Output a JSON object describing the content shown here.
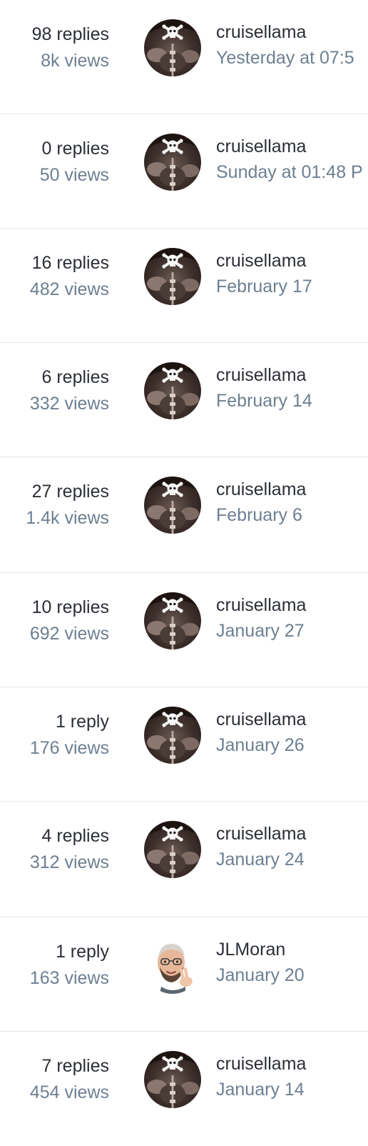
{
  "topics": [
    {
      "replies": "98 replies",
      "views": "8k views",
      "poster": "cruisellama",
      "date": "Yesterday at 07:5",
      "avatar": "pirate-skull-avatar"
    },
    {
      "replies": "0 replies",
      "views": "50 views",
      "poster": "cruisellama",
      "date": "Sunday at 01:48 P",
      "avatar": "pirate-skull-avatar"
    },
    {
      "replies": "16 replies",
      "views": "482 views",
      "poster": "cruisellama",
      "date": "February 17",
      "avatar": "pirate-skull-avatar"
    },
    {
      "replies": "6 replies",
      "views": "332 views",
      "poster": "cruisellama",
      "date": "February 14",
      "avatar": "pirate-skull-avatar"
    },
    {
      "replies": "27 replies",
      "views": "1.4k views",
      "poster": "cruisellama",
      "date": "February 6",
      "avatar": "pirate-skull-avatar"
    },
    {
      "replies": "10 replies",
      "views": "692 views",
      "poster": "cruisellama",
      "date": "January 27",
      "avatar": "pirate-skull-avatar"
    },
    {
      "replies": "1 reply",
      "views": "176 views",
      "poster": "cruisellama",
      "date": "January 26",
      "avatar": "pirate-skull-avatar"
    },
    {
      "replies": "4 replies",
      "views": "312 views",
      "poster": "cruisellama",
      "date": "January 24",
      "avatar": "pirate-skull-avatar"
    },
    {
      "replies": "1 reply",
      "views": "163 views",
      "poster": "JLMoran",
      "date": "January 20",
      "avatar": "memoji-peace-avatar"
    },
    {
      "replies": "7 replies",
      "views": "454 views",
      "poster": "cruisellama",
      "date": "January 14",
      "avatar": "pirate-skull-avatar"
    }
  ],
  "colors": {
    "primary_text": "#2b2f36",
    "secondary_text": "#6d7f92",
    "divider": "#e6e8eb"
  }
}
